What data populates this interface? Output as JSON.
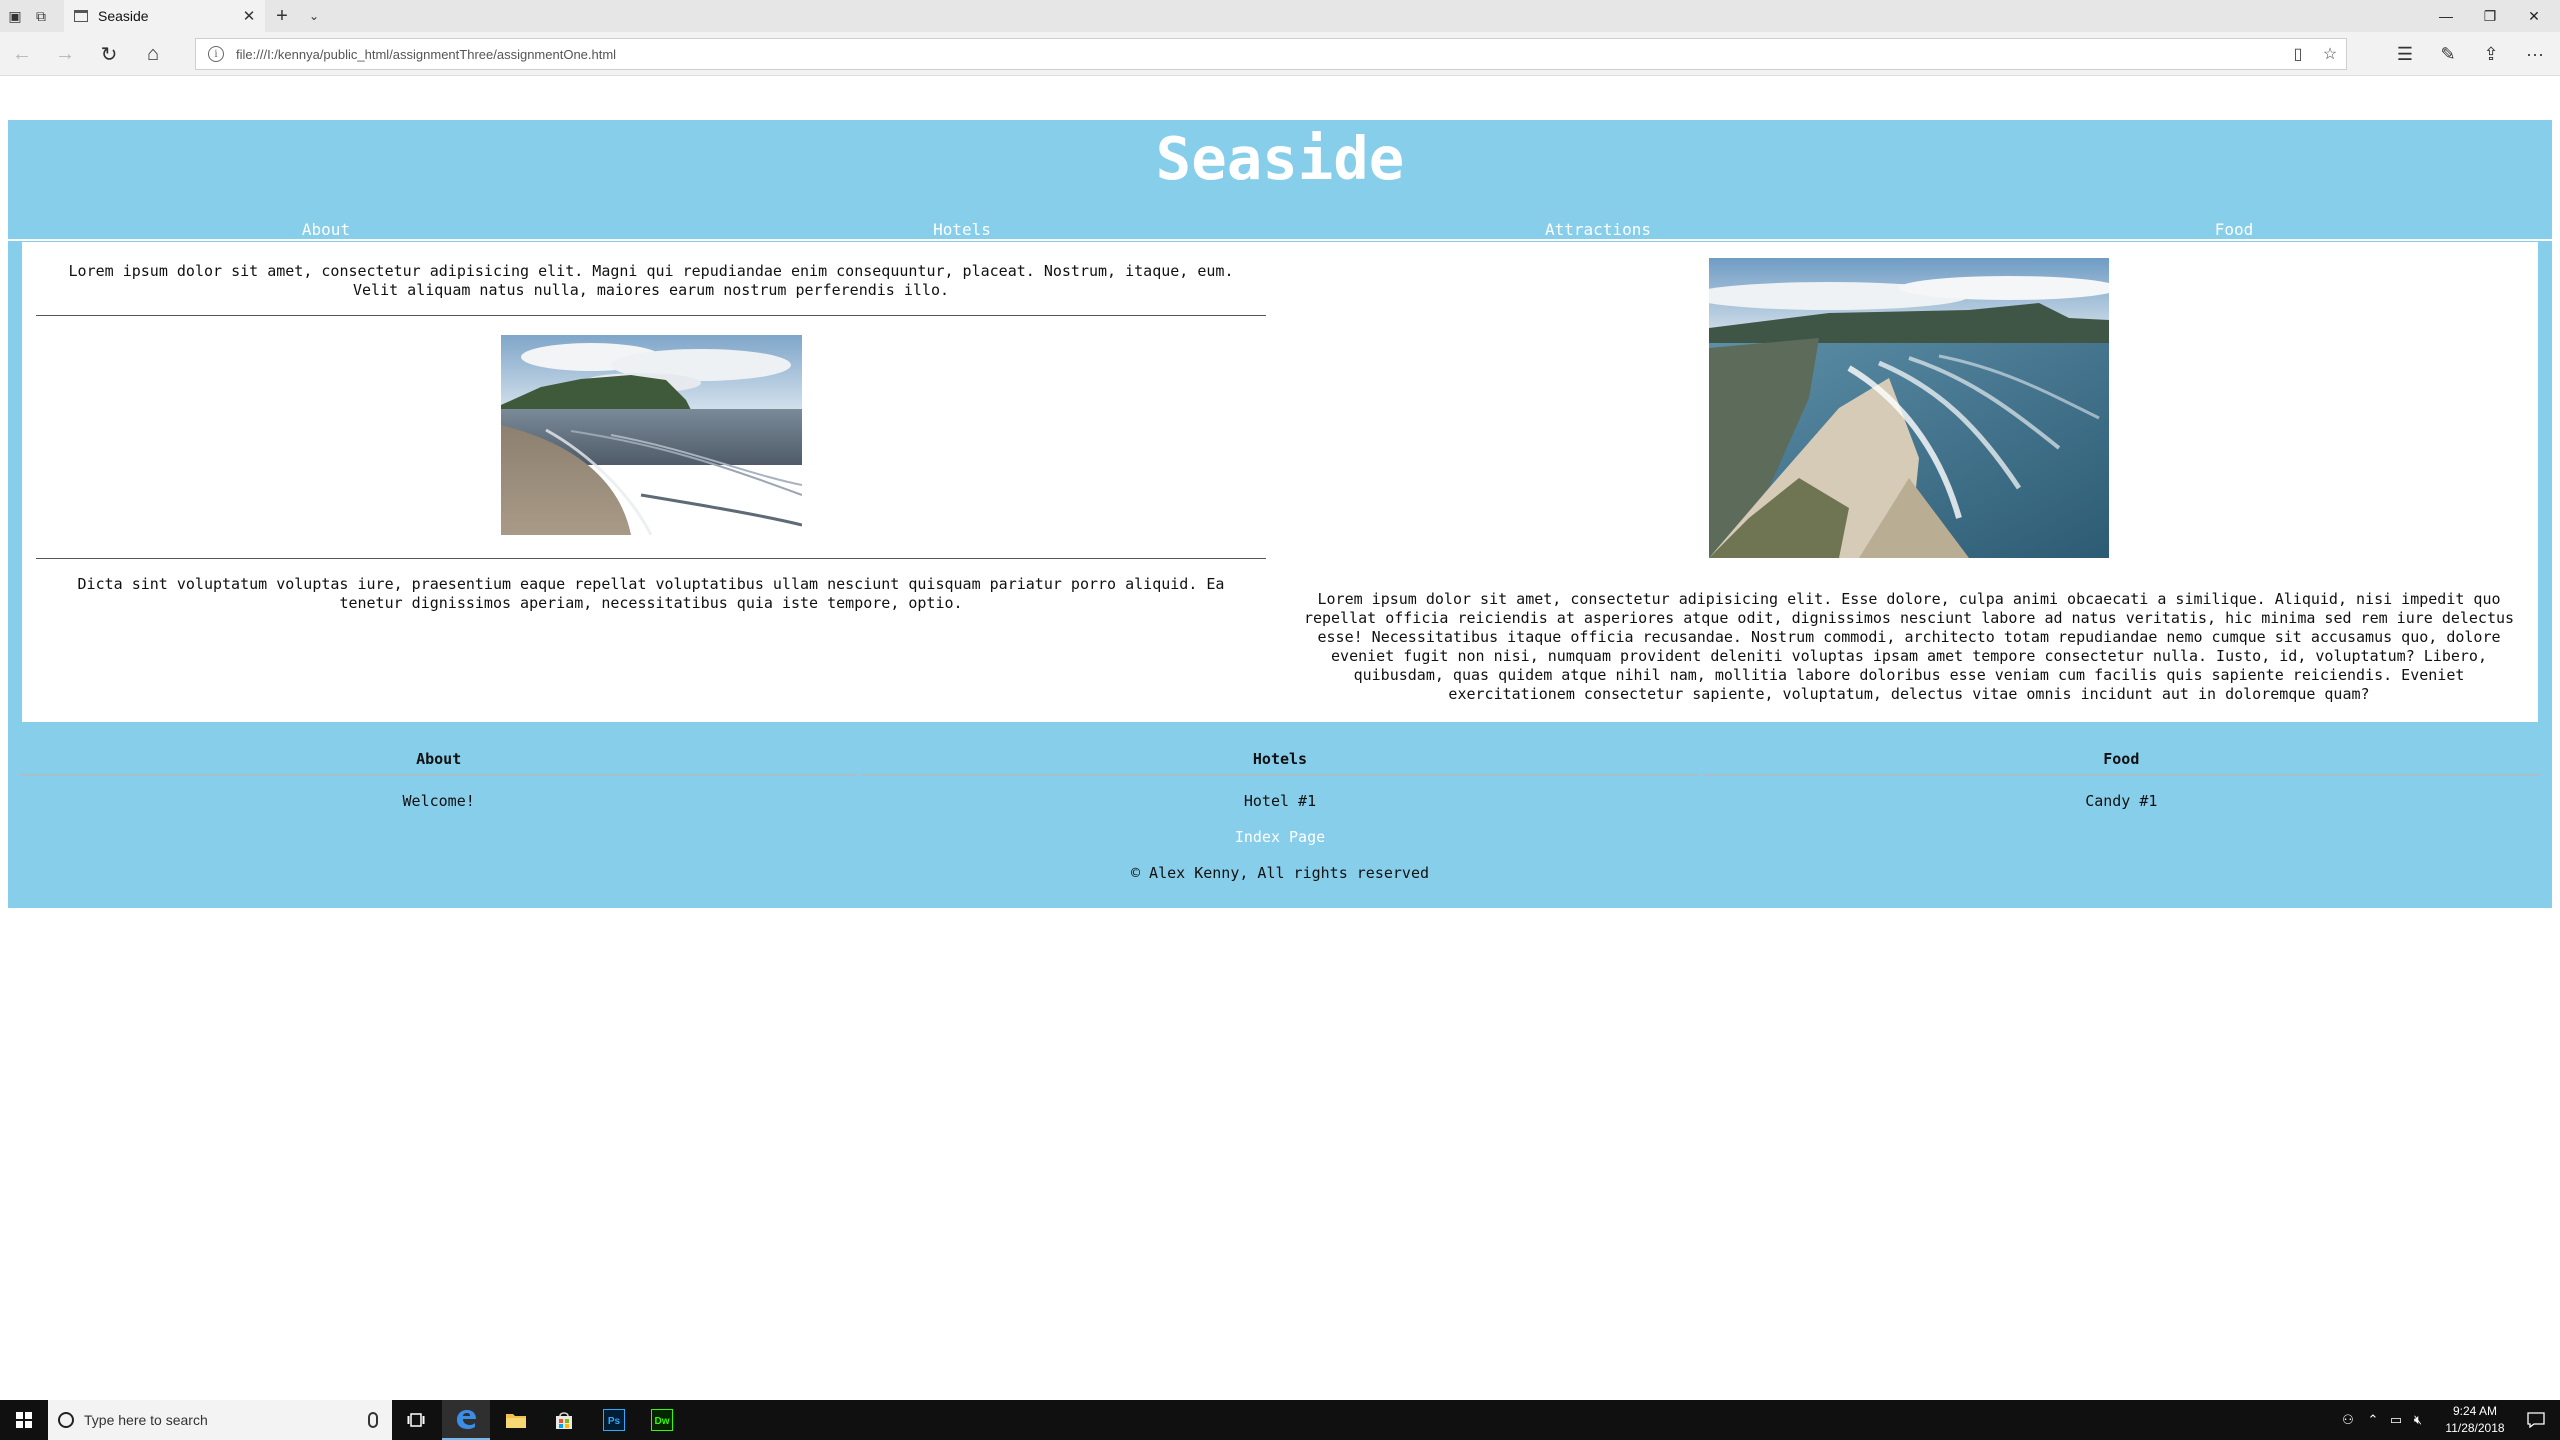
{
  "browser": {
    "tab_title": "Seaside",
    "url": "file:///I:/kennya/public_html/assignmentThree/assignmentOne.html"
  },
  "site": {
    "title": "Seaside",
    "nav": [
      "About",
      "Hotels",
      "Attractions",
      "Food"
    ],
    "left_text_1": "Lorem ipsum dolor sit amet, consectetur adipisicing elit. Magni qui repudiandae enim consequuntur, placeat. Nostrum, itaque, eum. Velit aliquam natus nulla, maiores earum nostrum perferendis illo.",
    "left_text_2": "Dicta sint voluptatum voluptas iure, praesentium eaque repellat voluptatibus ullam nesciunt quisquam pariatur porro aliquid. Ea tenetur dignissimos aperiam, necessitatibus quia iste tempore, optio.",
    "right_text": "Lorem ipsum dolor sit amet, consectetur adipisicing elit. Esse dolore, culpa animi obcaecati a similique. Aliquid, nisi impedit quo repellat officia reiciendis at asperiores atque odit, dignissimos nesciunt labore ad natus veritatis, hic minima sed rem iure delectus esse! Necessitatibus itaque officia recusandae. Nostrum commodi, architecto totam repudiandae nemo cumque sit accusamus quo, dolore eveniet fugit non nisi, numquam provident deleniti voluptas ipsam amet tempore consectetur nulla. Iusto, id, voluptatum? Libero, quibusdam, quas quidem atque nihil nam, mollitia labore doloribus esse veniam cum facilis quis sapiente reiciendis. Eveniet exercitationem consectetur sapiente, voluptatum, delectus vitae omnis incidunt aut in doloremque quam?",
    "footer": {
      "columns": [
        {
          "heading": "About",
          "item": "Welcome!"
        },
        {
          "heading": "Hotels",
          "item": "Hotel #1"
        },
        {
          "heading": "Food",
          "item": "Candy #1"
        }
      ],
      "index_link": "Index Page",
      "copyright": "© Alex Kenny, All rights reserved"
    }
  },
  "taskbar": {
    "search_placeholder": "Type here to search",
    "time": "9:24 AM",
    "date": "11/28/2018"
  },
  "colors": {
    "site_blue": "#87ceeb"
  }
}
